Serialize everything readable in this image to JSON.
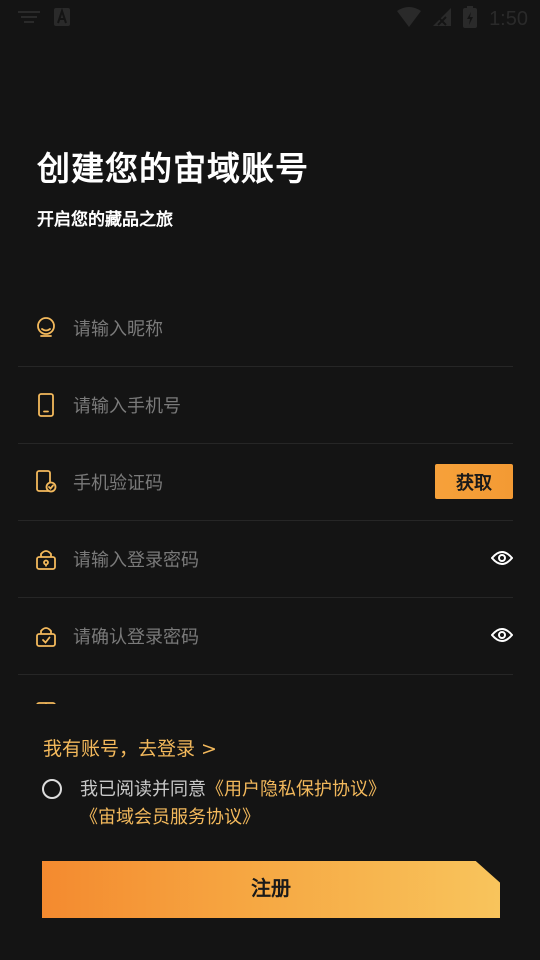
{
  "status_bar": {
    "time": "1:50"
  },
  "header": {
    "title": "创建您的宙域账号",
    "subtitle": "开启您的藏品之旅"
  },
  "form": {
    "nickname_placeholder": "请输入昵称",
    "phone_placeholder": "请输入手机号",
    "sms_placeholder": "手机验证码",
    "get_code_label": "获取",
    "password_placeholder": "请输入登录密码",
    "confirm_password_placeholder": "请确认登录密码"
  },
  "login_link": "我有账号，去登录 >",
  "agreement": {
    "prefix": "我已阅读并同意",
    "privacy": "《用户隐私保护协议》",
    "service": "《宙域会员服务协议》",
    "checked": false
  },
  "register_label": "注册",
  "colors": {
    "accent": "#f3b95c",
    "button_start": "#f48a2f",
    "button_end": "#f8c45c",
    "background": "#141414"
  }
}
